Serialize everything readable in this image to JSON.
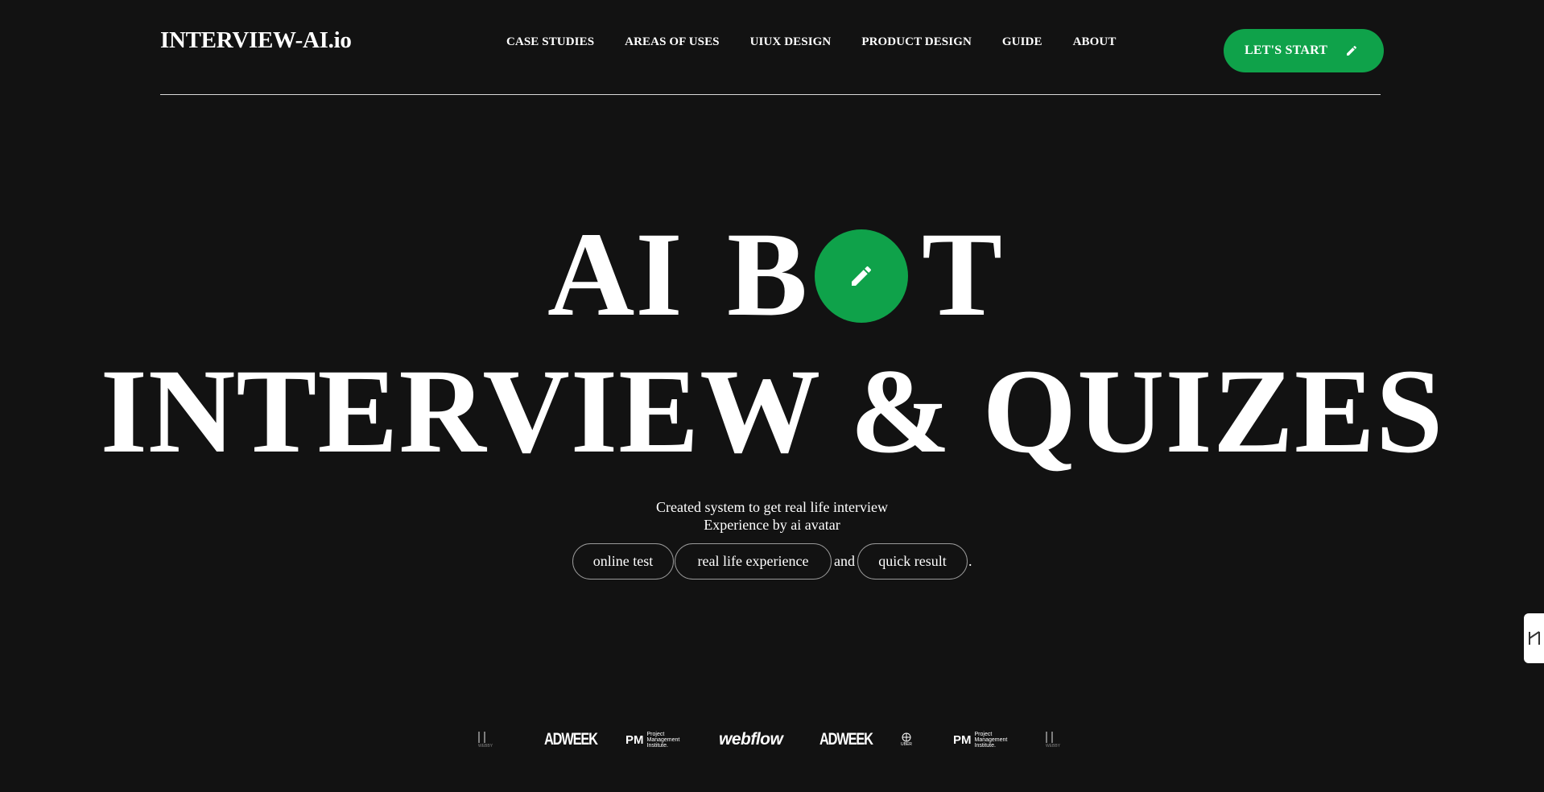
{
  "brand": "INTERVIEW-AI.io",
  "nav": [
    "CASE STUDIES",
    "AREAS OF USES",
    "UIUX DESIGN",
    "PRODUCT DESIGN",
    "GUIDE",
    "ABOUT"
  ],
  "cta": {
    "label": "LET'S START",
    "icon": "pencil-icon"
  },
  "hero": {
    "line1": [
      "AI",
      "B",
      "T"
    ],
    "circle_icon": "pencil-icon",
    "line2": "INTERVIEW & QUIZES"
  },
  "subtitle": [
    "Created system to get real life interview",
    "Experience by ai avatar"
  ],
  "pills": {
    "items": [
      "online test",
      "real life experience",
      "quick result"
    ],
    "connector": "and",
    "end": "."
  },
  "side_tab": {
    "icon": "bracket-icon"
  },
  "logos": {
    "items": [
      "WEBBY",
      "ADWEEK",
      "PM",
      "Project",
      "Management",
      "Institute.",
      "webflow",
      "ADWEEK",
      "UBER",
      "PM",
      "Project",
      "Management",
      "Institute.",
      "WEBBY"
    ]
  },
  "colors": {
    "accent": "#0fa24a",
    "background": "#121212",
    "text": "#ffffff"
  }
}
